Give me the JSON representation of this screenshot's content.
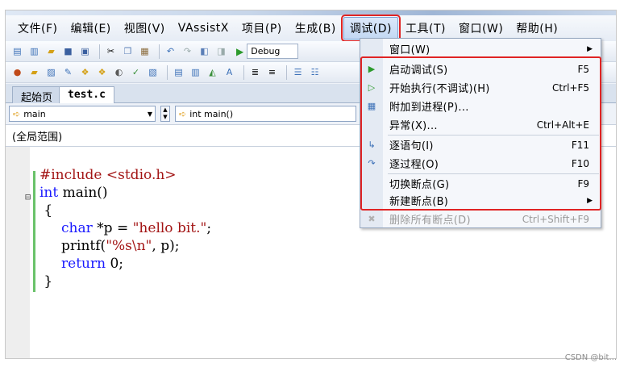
{
  "menubar": {
    "items": [
      "文件(F)",
      "编辑(E)",
      "视图(V)",
      "VAssistX",
      "项目(P)",
      "生成(B)",
      "调试(D)",
      "工具(T)",
      "窗口(W)",
      "帮助(H)"
    ]
  },
  "toolbar": {
    "config_combo": "Debug"
  },
  "tabs": [
    "起始页",
    "test.c"
  ],
  "nav": {
    "left_combo": "main",
    "right_combo": "int main()"
  },
  "scope": "(全局范围)",
  "code": {
    "line1": "#include <stdio.h>",
    "line2_kw": "int",
    "line2_rest": " main()",
    "line3": "{",
    "line4_kw": "char",
    "line4_mid": " *p = ",
    "line4_str": "\"hello bit.\"",
    "line4_end": ";",
    "line5_a": "printf(",
    "line5_str": "\"%s\\n\"",
    "line5_b": ", p);",
    "line6_kw": "return",
    "line6_rest": " 0;",
    "line7": "}"
  },
  "debug_menu": {
    "items": [
      {
        "label": "窗口(W)",
        "shortcut": "",
        "submenu": true
      },
      {
        "label": "启动调试(S)",
        "shortcut": "F5"
      },
      {
        "label": "开始执行(不调试)(H)",
        "shortcut": "Ctrl+F5"
      },
      {
        "label": "附加到进程(P)...",
        "shortcut": ""
      },
      {
        "label": "异常(X)...",
        "shortcut": "Ctrl+Alt+E"
      },
      {
        "label": "逐语句(I)",
        "shortcut": "F11"
      },
      {
        "label": "逐过程(O)",
        "shortcut": "F10"
      },
      {
        "label": "切换断点(G)",
        "shortcut": "F9"
      },
      {
        "label": "新建断点(B)",
        "shortcut": "",
        "submenu": true
      },
      {
        "label": "删除所有断点(D)",
        "shortcut": "Ctrl+Shift+F9",
        "disabled": true
      }
    ],
    "highlight_color": "#e02424"
  },
  "watermark": "CSDN @bit..."
}
